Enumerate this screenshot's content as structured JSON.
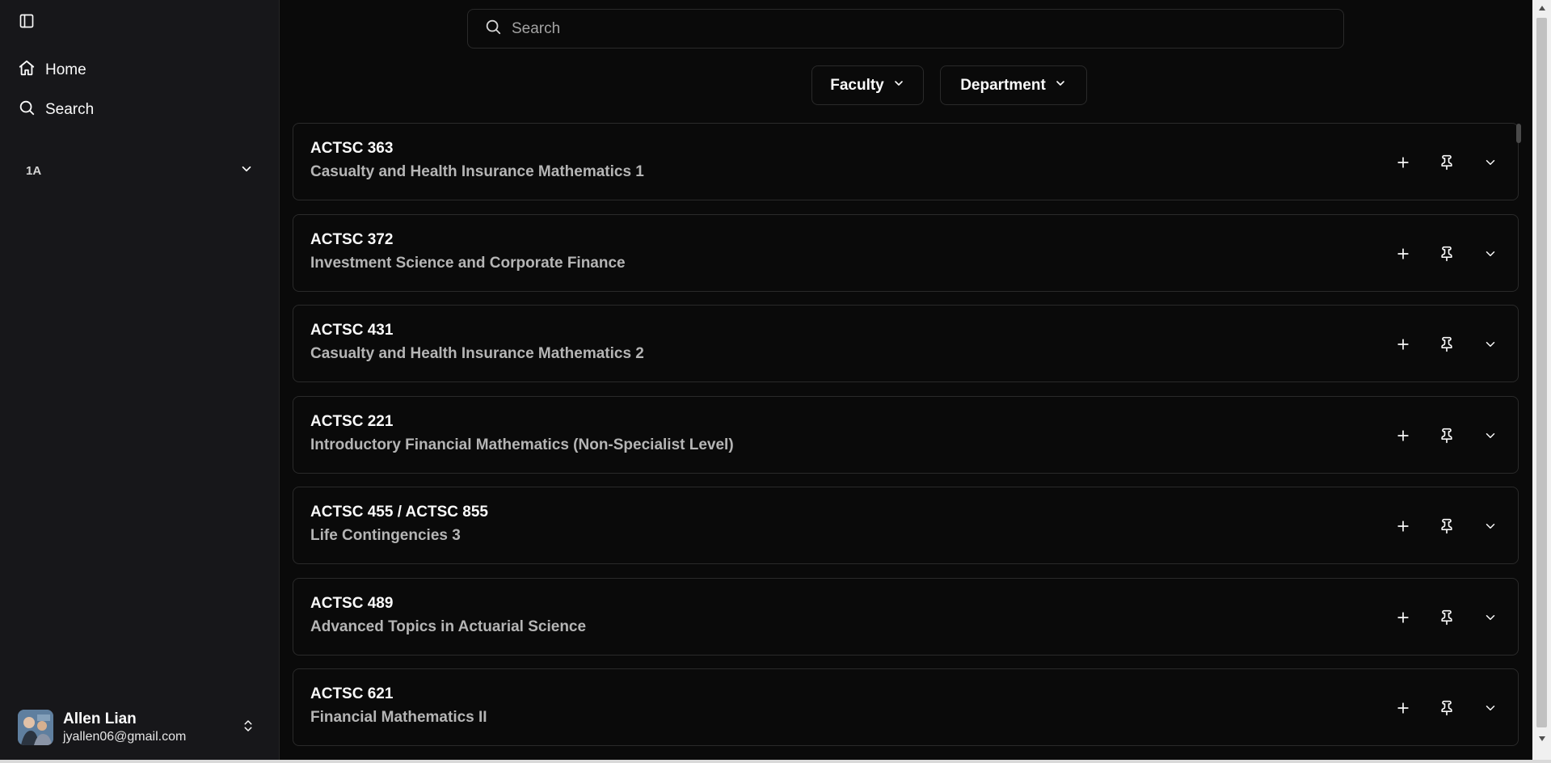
{
  "sidebar": {
    "nav": [
      {
        "label": "Home",
        "icon": "home-icon"
      },
      {
        "label": "Search",
        "icon": "search-icon"
      }
    ],
    "group_label": "1A",
    "user": {
      "name": "Allen Lian",
      "email": "jyallen06@gmail.com"
    }
  },
  "search": {
    "placeholder": "Search",
    "value": ""
  },
  "filters": {
    "faculty_label": "Faculty",
    "department_label": "Department"
  },
  "courses": [
    {
      "code": "ACTSC 363",
      "title": "Casualty and Health Insurance Mathematics 1"
    },
    {
      "code": "ACTSC 372",
      "title": "Investment Science and Corporate Finance"
    },
    {
      "code": "ACTSC 431",
      "title": "Casualty and Health Insurance Mathematics 2"
    },
    {
      "code": "ACTSC 221",
      "title": "Introductory Financial Mathematics (Non-Specialist Level)"
    },
    {
      "code": "ACTSC 455 / ACTSC 855",
      "title": "Life Contingencies 3"
    },
    {
      "code": "ACTSC 489",
      "title": "Advanced Topics in Actuarial Science"
    },
    {
      "code": "ACTSC 621",
      "title": "Financial Mathematics II"
    }
  ],
  "colors": {
    "sidebar_bg": "#17171a",
    "main_bg": "#0a0a0a",
    "border": "#2a2a2a",
    "text": "#fafafa",
    "muted_text": "#b5b5b5"
  }
}
